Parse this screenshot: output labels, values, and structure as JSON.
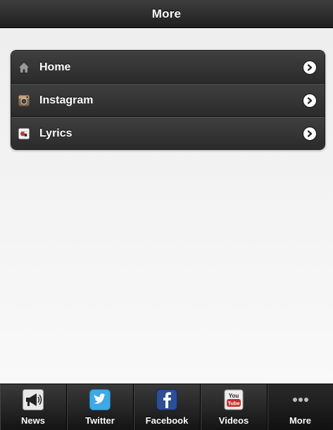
{
  "header": {
    "title": "More"
  },
  "menu": {
    "items": [
      {
        "label": "Home",
        "icon": "home-icon"
      },
      {
        "label": "Instagram",
        "icon": "instagram-icon"
      },
      {
        "label": "Lyrics",
        "icon": "lyrics-icon"
      }
    ]
  },
  "tabbar": {
    "tabs": [
      {
        "label": "News",
        "icon": "megaphone-icon"
      },
      {
        "label": "Twitter",
        "icon": "twitter-icon"
      },
      {
        "label": "Facebook",
        "icon": "facebook-icon"
      },
      {
        "label": "Videos",
        "icon": "youtube-icon"
      },
      {
        "label": "More",
        "icon": "more-dots-icon",
        "active": true
      }
    ]
  },
  "colors": {
    "header_bg": "#2b2b2b",
    "list_bg": "#333333",
    "tabbar_bg": "#1f1f1f",
    "twitter_blue": "#3fa9e5",
    "facebook_blue": "#2d4f95",
    "youtube_red": "#c4302b"
  }
}
